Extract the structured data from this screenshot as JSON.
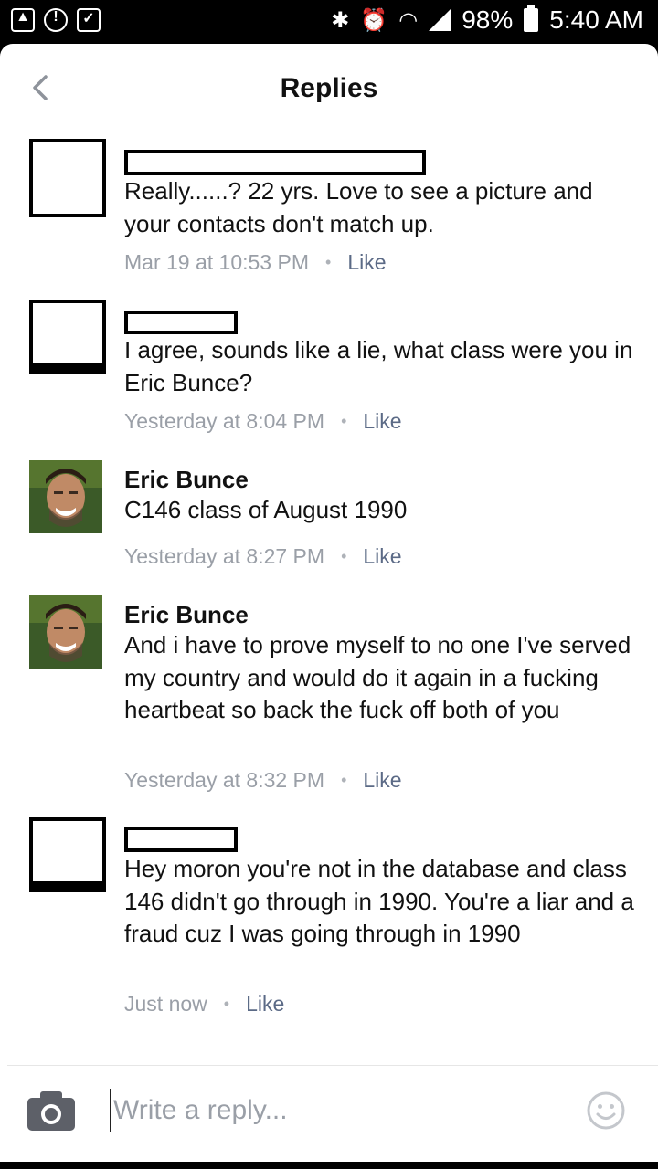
{
  "status_bar": {
    "left_icons": [
      "gallery-icon",
      "download-icon",
      "clipboard-check-icon"
    ],
    "right_icons": [
      "bluetooth-icon",
      "alarm-icon",
      "wifi-icon",
      "signal-icon"
    ],
    "battery": "98%",
    "time": "5:40 AM"
  },
  "header": {
    "title": "Replies",
    "back_icon": "chevron-left-icon"
  },
  "comments": [
    {
      "author": "",
      "author_redacted": true,
      "text": "Really......? 22 yrs. Love to see a picture and your contacts don't match up.",
      "timestamp": "Mar 19 at 10:53 PM",
      "like_label": "Like"
    },
    {
      "author": "",
      "author_redacted": true,
      "text": "I agree, sounds like a lie, what class were you in Eric Bunce?",
      "timestamp": "Yesterday at 8:04 PM",
      "like_label": "Like"
    },
    {
      "author": "Eric Bunce",
      "author_redacted": false,
      "text": "C146 class of August 1990",
      "timestamp": "Yesterday at 8:27 PM",
      "like_label": "Like"
    },
    {
      "author": "Eric Bunce",
      "author_redacted": false,
      "text": "And i have to prove myself to no one I've served my country and would do it again in a fucking heartbeat so back the fuck off both of you",
      "timestamp": "Yesterday at 8:32 PM",
      "like_label": "Like"
    },
    {
      "author": "",
      "author_redacted": true,
      "text": "Hey moron you're not in the database and class 146 didn't go through in 1990. You're a liar and a fraud cuz I was going through in 1990",
      "timestamp": "Just now",
      "like_label": "Like"
    }
  ],
  "separator": "•",
  "composer": {
    "placeholder": "Write a reply...",
    "camera_icon": "camera-icon",
    "emoji_icon": "smiley-icon"
  },
  "colors": {
    "text": "#111111",
    "meta": "#9a9fa7",
    "like": "#5b6a86",
    "statusbar": "#000000"
  }
}
